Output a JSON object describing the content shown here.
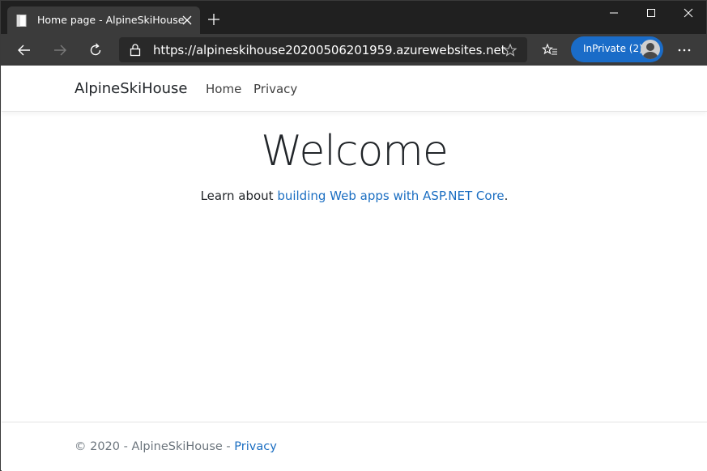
{
  "browser": {
    "tab": {
      "title": "Home page - AlpineSkiHouse"
    },
    "address_bar": {
      "url": "https://alpineskihouse20200506201959.azurewebsites.net"
    },
    "profile": {
      "label": "InPrivate (2)"
    },
    "colors": {
      "titlebar": "#202020",
      "toolbar": "#3b3b3b",
      "omnibox": "#292929",
      "profile_pill": "#1a6cc8"
    }
  },
  "site": {
    "brand": "AlpineSkiHouse",
    "nav": [
      {
        "label": "Home"
      },
      {
        "label": "Privacy"
      }
    ],
    "hero": {
      "title": "Welcome",
      "text_prefix": "Learn about ",
      "link_text": "building Web apps with ASP.NET Core",
      "text_suffix": "."
    },
    "footer": {
      "text": "© 2020 - AlpineSkiHouse - ",
      "link_text": "Privacy"
    },
    "colors": {
      "link": "#1b6ec2",
      "text": "#212529",
      "muted": "#6c757d"
    }
  }
}
